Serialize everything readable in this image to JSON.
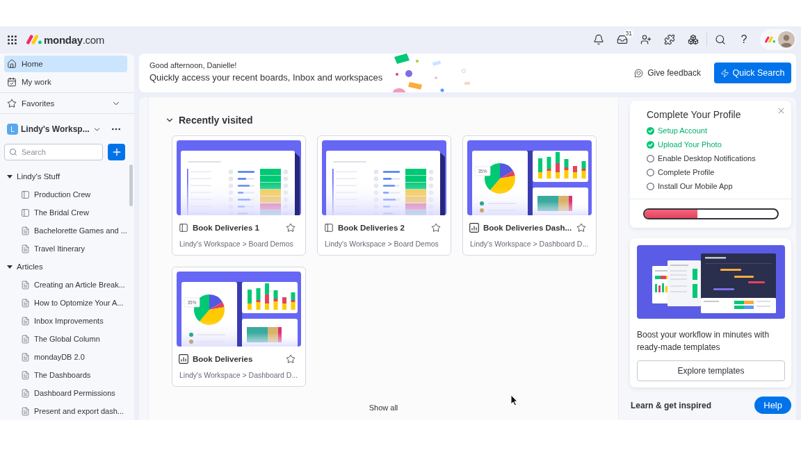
{
  "topbar": {
    "logo_text": "**monday**.com",
    "inbox_badge": "31",
    "help_glyph": "?"
  },
  "sidebar": {
    "nav": [
      {
        "kind": "home",
        "label": "Home",
        "selected": true
      },
      {
        "kind": "my_work",
        "label": "My work",
        "selected": false
      }
    ],
    "favorites": {
      "label": "Favorites",
      "expanded": false
    },
    "workspace": {
      "initial": "L",
      "name": "Lindy's Worksp..."
    },
    "search": {
      "placeholder": "Search"
    },
    "folders": [
      {
        "label": "Lindy's Stuff",
        "expanded": true,
        "children": [
          {
            "kind": "board",
            "label": "Production Crew"
          },
          {
            "kind": "board",
            "label": "The Bridal Crew"
          },
          {
            "kind": "doc",
            "label": "Bachelorette Games and ..."
          },
          {
            "kind": "doc",
            "label": "Travel Itinerary"
          }
        ]
      },
      {
        "label": "Articles",
        "expanded": true,
        "children": [
          {
            "kind": "doc",
            "label": "Creating an Article Break..."
          },
          {
            "kind": "doc",
            "label": "How to Optomize Your A..."
          },
          {
            "kind": "doc",
            "label": "Inbox Improvements"
          },
          {
            "kind": "doc",
            "label": "The Global Column"
          },
          {
            "kind": "doc",
            "label": "mondayDB 2.0"
          },
          {
            "kind": "doc",
            "label": "The Dashboards"
          },
          {
            "kind": "doc",
            "label": "Dashboard Permissions"
          },
          {
            "kind": "doc",
            "label": "Present and export dash..."
          }
        ]
      }
    ]
  },
  "header": {
    "greeting": "Good afternoon, Danielle!",
    "subtitle": "Quickly access your recent boards, Inbox and workspaces",
    "feedback_button": "Give feedback",
    "search_button": "Quick Search"
  },
  "recent": {
    "title": "Recently visited",
    "expanded": true,
    "items": [
      {
        "kind": "board",
        "title": "Book Deliveries 1",
        "path": "Lindy's Workspace > Board Demos",
        "starred": false
      },
      {
        "kind": "board",
        "title": "Book Deliveries 2",
        "path": "Lindy's Workspace > Board Demos",
        "starred": false
      },
      {
        "kind": "dashboard",
        "title": "Book Deliveries Dash...",
        "path": "Lindy's Workspace > Dashboard D...",
        "preview_label": "35%",
        "starred": false
      },
      {
        "kind": "dashboard",
        "title": "Book Deliveries",
        "path": "Lindy's Workspace > Dashboard D...",
        "preview_label": "35%",
        "starred": false
      }
    ],
    "show_all": "Show all"
  },
  "profile": {
    "title": "Complete Your Profile",
    "tasks": [
      {
        "label": "Setup Account",
        "done": true
      },
      {
        "label": "Upload Your Photo",
        "done": true
      },
      {
        "label": "Enable Desktop Notifications",
        "done": false
      },
      {
        "label": "Complete Profile",
        "done": false
      },
      {
        "label": "Install Our Mobile App",
        "done": false
      }
    ],
    "progress": {
      "level": 0.4
    }
  },
  "templates": {
    "text": "Boost your workflow in minutes with ready-made templates",
    "button": "Explore templates"
  },
  "learn": {
    "title": "Learn & get inspired",
    "help_button": "Help"
  }
}
